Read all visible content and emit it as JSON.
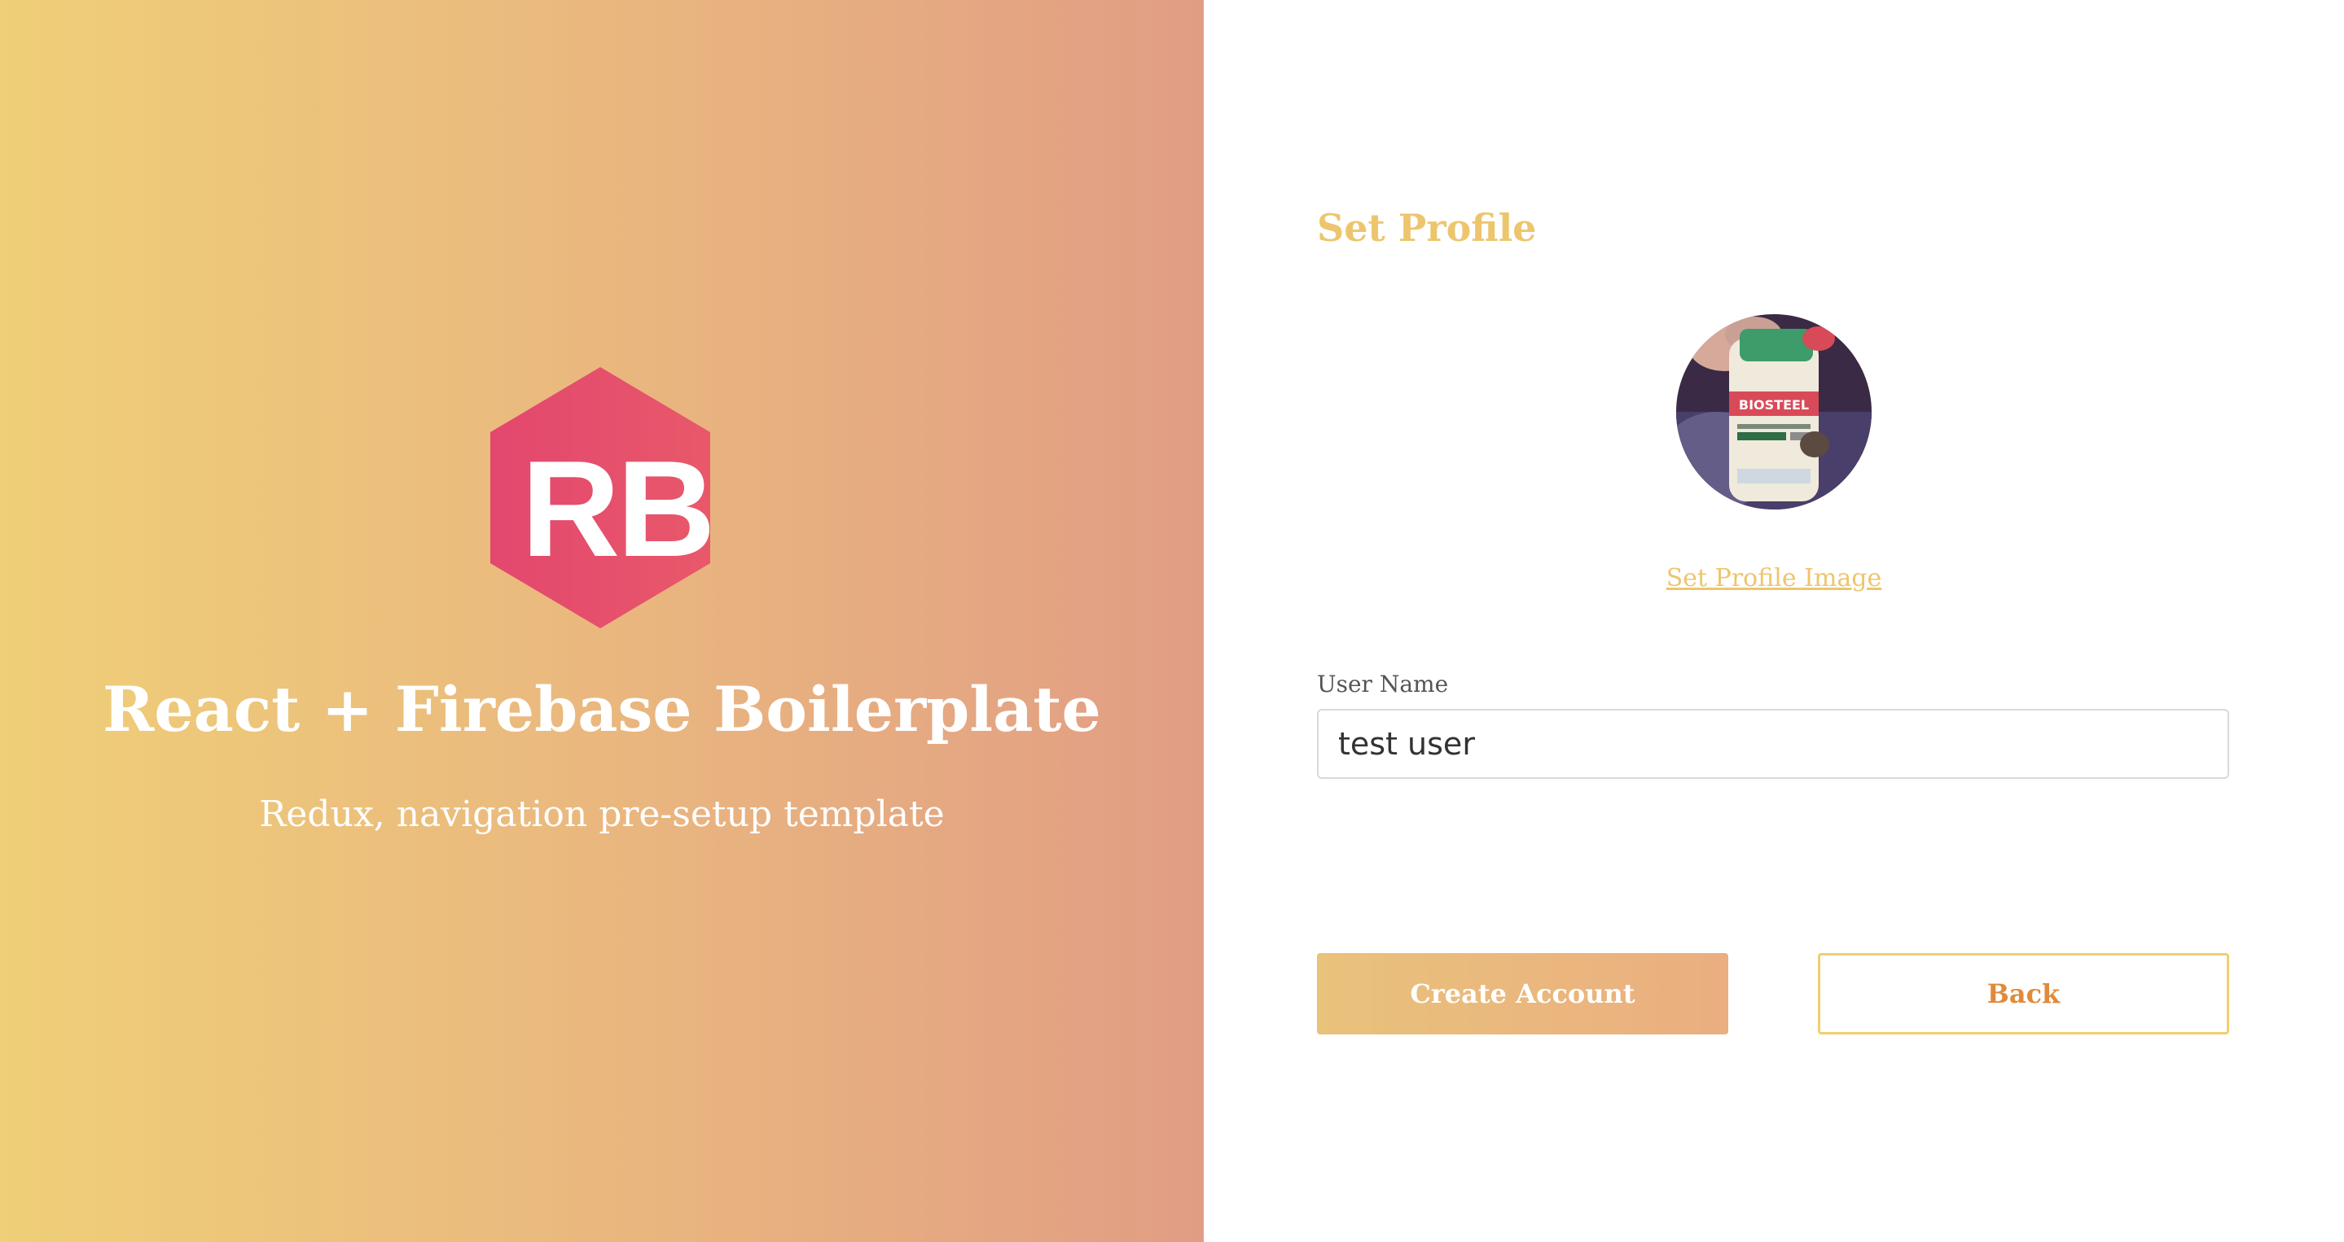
{
  "brand": {
    "logo_text": "RB",
    "logo_color_start": "#e3476e",
    "logo_color_end": "#e8576a",
    "title": "React + Firebase Boilerplate",
    "subtitle": "Redux, navigation pre-setup template",
    "gradient_start": "#efcf78",
    "gradient_end": "#e19d84"
  },
  "form": {
    "title": "Set Profile",
    "profile_image_link": "Set Profile Image",
    "user_name_label": "User Name",
    "user_name_value": "test user",
    "create_account_label": "Create Account",
    "back_label": "Back",
    "accent_color": "#edc56d"
  },
  "avatar": {
    "image_label": "BIOSTEEL"
  }
}
